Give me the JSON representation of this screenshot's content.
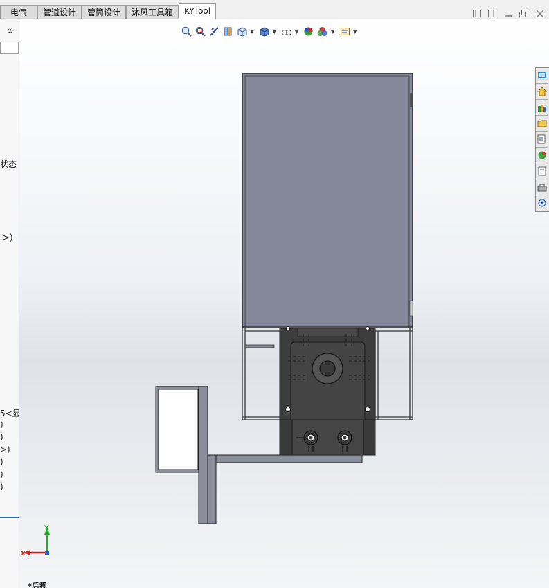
{
  "tabs": [
    {
      "label": "电气"
    },
    {
      "label": "管道设计"
    },
    {
      "label": "管筒设计"
    },
    {
      "label": "沐风工具箱"
    },
    {
      "label": "KYTool"
    }
  ],
  "left_panel": {
    "expand_label": "»",
    "tree_fragments": [
      {
        "text": "状态"
      },
      {
        "text": ".>)"
      },
      {
        "text": "5<显"
      },
      {
        "text": ")"
      },
      {
        "text": ")"
      },
      {
        "text": ">)"
      },
      {
        "text": ")"
      },
      {
        "text": ")"
      },
      {
        "text": ")"
      }
    ]
  },
  "hud_toolbar": {
    "icons": [
      "zoom-to-fit-icon",
      "zoom-to-area-icon",
      "previous-view-icon",
      "section-view-icon",
      "view-orientation-icon",
      "display-style-icon",
      "hide-show-items-icon",
      "edit-appearance-icon",
      "apply-scene-icon",
      "view-settings-icon"
    ]
  },
  "task_pane": {
    "icons": [
      "solidworks-resources-icon",
      "home-icon",
      "design-library-icon",
      "file-explorer-icon",
      "view-palette-icon",
      "appearances-icon",
      "custom-properties-icon",
      "toolbox-icon",
      "3d-contentcentral-icon"
    ]
  },
  "window_controls": {
    "icons": [
      "tile-horizontal-icon",
      "tile-vertical-icon",
      "minimize-icon",
      "restore-icon",
      "close-icon"
    ]
  },
  "triad": {
    "x_label": "X",
    "y_label": "Y"
  },
  "view": {
    "name": "*后视"
  },
  "colors": {
    "steel_blue_panel": "#868a9c",
    "dark_bracket": "#3c3c3c",
    "frame_gray": "#8a8e9a",
    "x_axis": "#cc2222",
    "y_axis": "#22aa22"
  }
}
